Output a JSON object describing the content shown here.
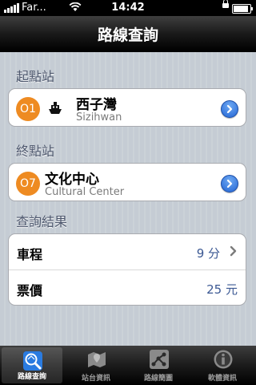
{
  "status_bar": {
    "carrier": "Far...",
    "time": "14:42"
  },
  "nav": {
    "title": "路線查詢"
  },
  "origin": {
    "section_title": "起點站",
    "line_code": "O1",
    "name": "西子灣",
    "name_en": "Sizihwan",
    "icon": "ferry-icon"
  },
  "destination": {
    "section_title": "終點站",
    "line_code": "O7",
    "name": "文化中心",
    "name_en": "Cultural Center"
  },
  "results": {
    "section_title": "查詢結果",
    "rows": [
      {
        "label": "車程",
        "value": "9 分"
      },
      {
        "label": "票價",
        "value": "25 元"
      }
    ]
  },
  "tabs": [
    {
      "label": "路線查詢",
      "icon": "route-search-icon",
      "selected": true
    },
    {
      "label": "站台資訊",
      "icon": "station-map-icon",
      "selected": false
    },
    {
      "label": "路線簡圖",
      "icon": "route-diagram-icon",
      "selected": false
    },
    {
      "label": "軟體資訊",
      "icon": "info-icon",
      "selected": false
    }
  ],
  "colors": {
    "line_orange": "#ee8b22",
    "accent_blue": "#2365d4",
    "value_blue": "#3b5893"
  }
}
